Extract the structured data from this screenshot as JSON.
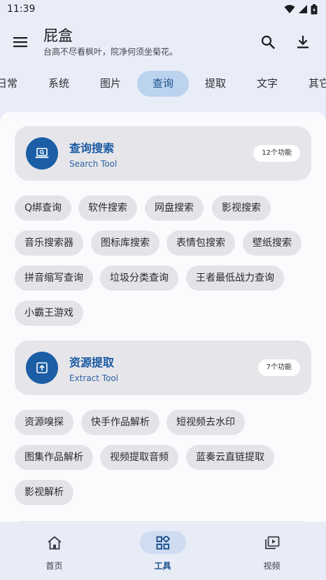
{
  "status_bar": {
    "time": "11:39"
  },
  "app_bar": {
    "title": "屁盒",
    "subtitle": "台高不尽看枫叶，院净何须坐菊花。"
  },
  "tabs": [
    "日常",
    "系统",
    "图片",
    "查询",
    "提取",
    "文字",
    "其它"
  ],
  "active_tab": "查询",
  "sections": [
    {
      "title": "查询搜索",
      "subtitle": "Search Tool",
      "count": "12个功能",
      "items": [
        "Q绑查询",
        "软件搜索",
        "网盘搜索",
        "影视搜索",
        "音乐搜索器",
        "图标库搜索",
        "表情包搜索",
        "壁纸搜索",
        "拼音缩写查询",
        "垃圾分类查询",
        "王者最低战力查询",
        "小霸王游戏"
      ]
    },
    {
      "title": "资源提取",
      "subtitle": "Extract Tool",
      "count": "7个功能",
      "items": [
        "资源嗅探",
        "快手作品解析",
        "短视频去水印",
        "图集作品解析",
        "视频提取音频",
        "蓝奏云直链提取",
        "影视解析"
      ]
    }
  ],
  "bottom_nav": [
    {
      "label": "首页",
      "icon": "home-icon",
      "active": false
    },
    {
      "label": "工具",
      "icon": "apps-icon",
      "active": true
    },
    {
      "label": "视频",
      "icon": "video-library-icon",
      "active": false
    }
  ],
  "colors": {
    "accent": "#1c5ea6",
    "active_tab_bg": "#bcd3ef",
    "chip_bg": "#e4e4e8",
    "section_bg": "#e6e6ea"
  }
}
